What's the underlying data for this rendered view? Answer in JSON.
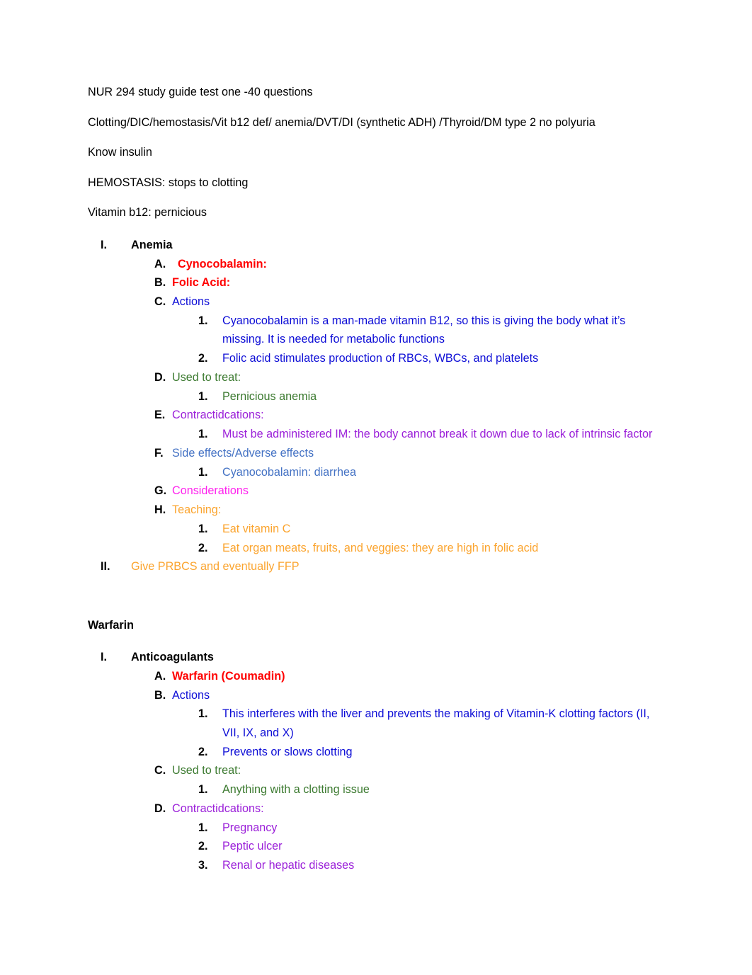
{
  "document": {
    "intro_paragraphs": [
      "NUR 294 study guide test one -40 questions",
      "Clotting/DIC/hemostasis/Vit b12 def/ anemia/DVT/DI (synthetic ADH) /Thyroid/DM type 2 no polyuria",
      "Know insulin",
      "HEMOSTASIS: stops to clotting",
      "Vitamin b12: pernicious"
    ],
    "anemia_section": {
      "item_1_marker": "I.",
      "item_1_text": "Anemia",
      "a_marker": "A.",
      "a_text": "Cynocobalamin:",
      "b_marker": "B.",
      "b_text": "Folic Acid:",
      "c_marker": "C.",
      "c_text": "Actions",
      "c1_marker": "1.",
      "c1_text": "Cyanocobalamin is a man-made vitamin B12, so this is giving the body what it’s missing. It is needed for metabolic functions",
      "c2_marker": "2.",
      "c2_text": "Folic acid stimulates production of RBCs, WBCs, and platelets",
      "d_marker": "D.",
      "d_text": "Used to treat:",
      "d1_marker": "1.",
      "d1_text": "Pernicious anemia",
      "e_marker": "E.",
      "e_text": "Contractidcations:",
      "e1_marker": "1.",
      "e1_text": "Must be administered IM: the body cannot break it down due to lack of intrinsic factor",
      "f_marker": "F.",
      "f_text": "Side effects/Adverse effects",
      "f1_marker": "1.",
      "f1_text": "Cyanocobalamin: diarrhea",
      "g_marker": "G.",
      "g_text": "Considerations",
      "h_marker": "H.",
      "h_text": "Teaching:",
      "h1_marker": "1.",
      "h1_text": "Eat vitamin C",
      "h2_marker": "2.",
      "h2_text": "Eat organ meats, fruits, and veggies: they are high in folic acid",
      "item_2_marker": "II.",
      "item_2_text": "Give PRBCS and eventually FFP"
    },
    "warfarin_section": {
      "heading": "Warfarin",
      "item_1_marker": "I.",
      "item_1_text": "Anticoagulants",
      "a_marker": "A.",
      "a_text": "Warfarin (Coumadin)",
      "b_marker": "B.",
      "b_text": "Actions",
      "b1_marker": "1.",
      "b1_text": "This interferes with the liver and prevents the making of Vitamin-K clotting factors (II, VII, IX, and X)",
      "b2_marker": "2.",
      "b2_text": "Prevents or slows clotting",
      "c_marker": "C.",
      "c_text": "Used to treat:",
      "c1_marker": "1.",
      "c1_text": "Anything with a clotting issue",
      "d_marker": "D.",
      "d_text": "Contractidcations:",
      "d1_marker": "1.",
      "d1_text": "Pregnancy",
      "d2_marker": "2.",
      "d2_text": "Peptic ulcer",
      "d3_marker": "3.",
      "d3_text": "Renal or hepatic diseases"
    },
    "colors": {
      "black": "#000000",
      "red": "#FF0000",
      "blue": "#0D0DD6",
      "green": "#3C7A30",
      "purple": "#9B20D9",
      "steel_blue": "#4472C4",
      "magenta": "#FF22EE",
      "orange": "#FBA42E"
    }
  }
}
